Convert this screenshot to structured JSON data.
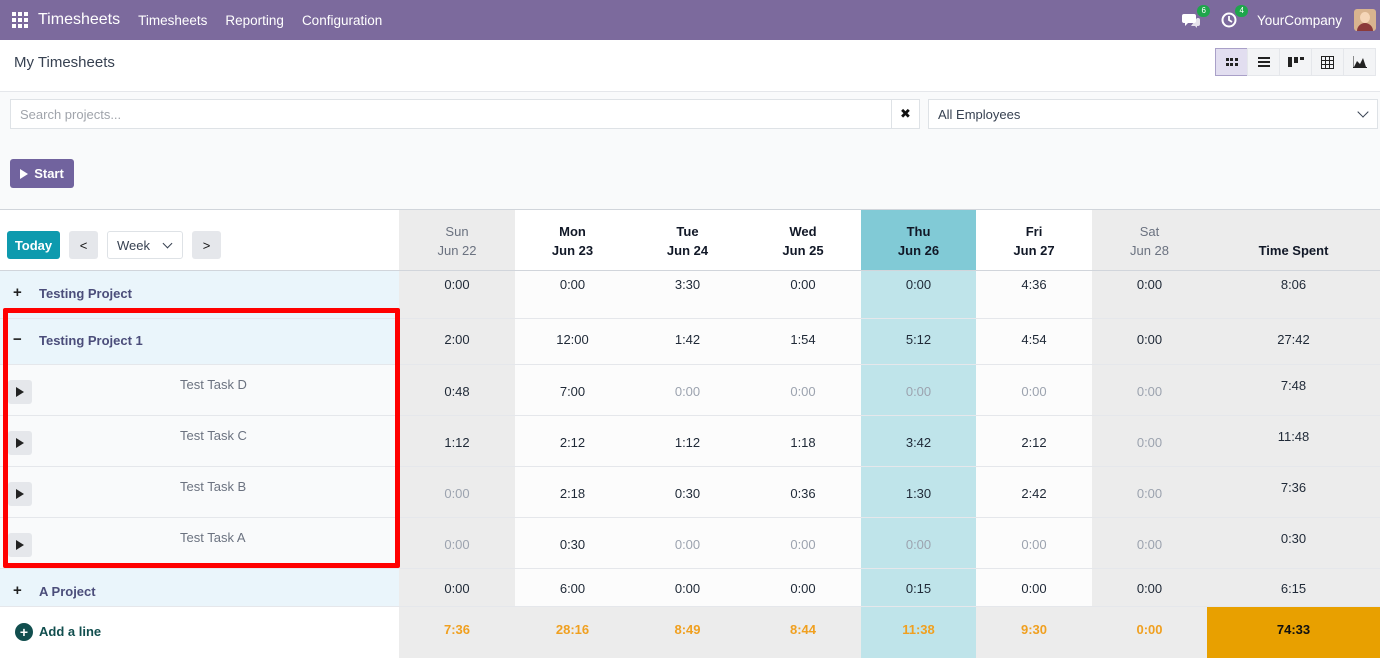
{
  "navbar": {
    "app_name": "Timesheets",
    "menu": [
      "Timesheets",
      "Reporting",
      "Configuration"
    ],
    "messages_badge": "6",
    "activities_badge": "4",
    "company": "YourCompany"
  },
  "control": {
    "title": "My Timesheets",
    "views": [
      "grid-view-icon",
      "list-view-icon",
      "kanban-view-icon",
      "pivot-view-icon",
      "graph-view-icon"
    ]
  },
  "search": {
    "placeholder": "Search projects...",
    "employee_filter": "All Employees"
  },
  "actions": {
    "start": "Start"
  },
  "grid_controls": {
    "today": "Today",
    "prev": "<",
    "next": ">",
    "range": "Week"
  },
  "days": [
    {
      "day": "Sun",
      "date": "Jun 22"
    },
    {
      "day": "Mon",
      "date": "Jun 23"
    },
    {
      "day": "Tue",
      "date": "Jun 24"
    },
    {
      "day": "Wed",
      "date": "Jun 25"
    },
    {
      "day": "Thu",
      "date": "Jun 26"
    },
    {
      "day": "Fri",
      "date": "Jun 27"
    },
    {
      "day": "Sat",
      "date": "Jun 28"
    }
  ],
  "total_header": "Time Spent",
  "rows": [
    {
      "sign": "+",
      "label": "Testing Project",
      "values": [
        "0:00",
        "0:00",
        "3:30",
        "0:00",
        "0:00",
        "4:36",
        "0:00"
      ],
      "total": "8:06"
    },
    {
      "sign": "−",
      "label": "Testing Project 1",
      "values": [
        "2:00",
        "12:00",
        "1:42",
        "1:54",
        "5:12",
        "4:54",
        "0:00"
      ],
      "total": "27:42"
    },
    {
      "label": "Test Task D",
      "values": [
        "0:48",
        "7:00",
        "0:00",
        "0:00",
        "0:00",
        "0:00",
        "0:00"
      ],
      "total": "7:48"
    },
    {
      "label": "Test Task C",
      "values": [
        "1:12",
        "2:12",
        "1:12",
        "1:18",
        "3:42",
        "2:12",
        "0:00"
      ],
      "total": "11:48"
    },
    {
      "label": "Test Task B",
      "values": [
        "0:00",
        "2:18",
        "0:30",
        "0:36",
        "1:30",
        "2:42",
        "0:00"
      ],
      "total": "7:36"
    },
    {
      "label": "Test Task A",
      "values": [
        "0:00",
        "0:30",
        "0:00",
        "0:00",
        "0:00",
        "0:00",
        "0:00"
      ],
      "total": "0:30"
    },
    {
      "sign": "+",
      "label": "A Project",
      "values": [
        "0:00",
        "6:00",
        "0:00",
        "0:00",
        "0:15",
        "0:00",
        "0:00"
      ],
      "total": "6:15"
    }
  ],
  "add_line": "Add a line",
  "daily_totals": [
    "7:36",
    "28:16",
    "8:49",
    "8:44",
    "11:38",
    "9:30",
    "0:00"
  ],
  "grand_total": "74:33",
  "colors": {
    "navbar": "#7c6a9d",
    "today": "#0e9aae",
    "grand_total": "#e8a000",
    "highlight": "#ff0000"
  }
}
